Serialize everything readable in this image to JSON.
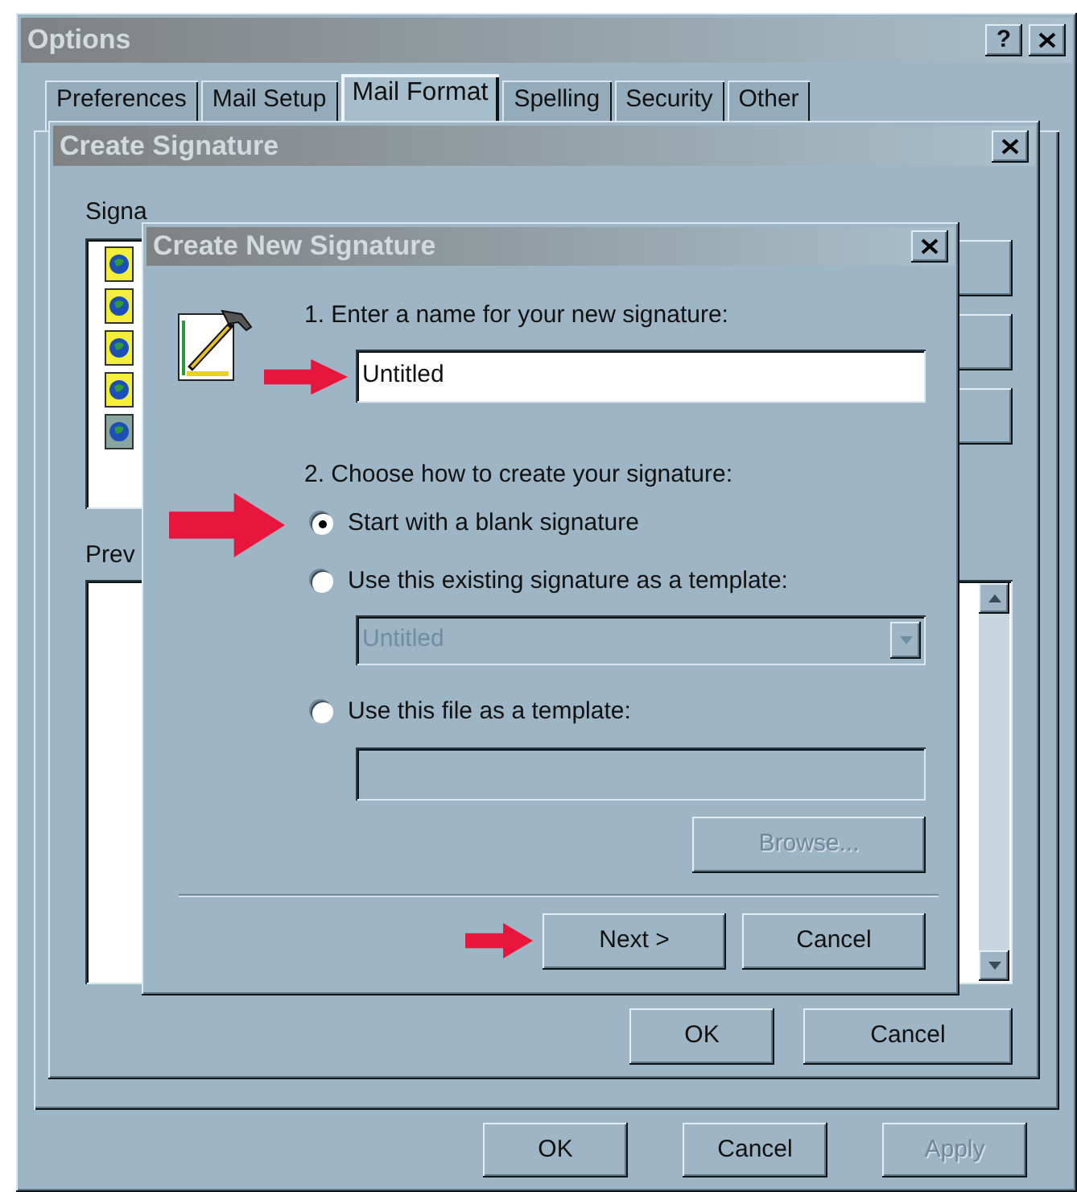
{
  "window": {
    "title": "Options",
    "help": "?"
  },
  "tabs": [
    {
      "label": "Preferences",
      "selected": false
    },
    {
      "label": "Mail Setup",
      "selected": false
    },
    {
      "label": "Mail Format",
      "selected": true
    },
    {
      "label": "Spelling",
      "selected": false
    },
    {
      "label": "Security",
      "selected": false
    },
    {
      "label": "Other",
      "selected": false
    }
  ],
  "create_signature": {
    "title": "Create Signature",
    "signature_label": "Signa",
    "signature_list": [
      {
        "selected": false
      },
      {
        "selected": false
      },
      {
        "selected": false
      },
      {
        "selected": false
      },
      {
        "selected": true
      }
    ],
    "preview_label": "Prev",
    "buttons": [
      {
        "label": "OK"
      },
      {
        "label": "Cancel"
      }
    ]
  },
  "create_new_signature": {
    "title": "Create New Signature",
    "step1_label": "1. Enter a name for your new signature:",
    "name_field": {
      "value": "Untitled",
      "pointed": true
    },
    "step2_label": "2. Choose how to create your signature:",
    "options": [
      {
        "label": "Start with a blank signature",
        "selected": true,
        "pointed": true
      },
      {
        "label": "Use this existing signature as a template:",
        "selected": false,
        "pointed": false,
        "select": {
          "value": "Untitled",
          "disabled": true
        }
      },
      {
        "label": "Use this file as a template:",
        "selected": false,
        "pointed": false,
        "file_field": {
          "disabled": true
        }
      }
    ],
    "browse_button": {
      "label": "Browse...",
      "disabled": true
    },
    "buttons": [
      {
        "label": "Next >",
        "pointed": true
      },
      {
        "label": "Cancel",
        "pointed": false
      }
    ]
  },
  "buttons": [
    {
      "label": "OK",
      "disabled": false
    },
    {
      "label": "Cancel",
      "disabled": false
    },
    {
      "label": "Apply",
      "disabled": true
    }
  ]
}
